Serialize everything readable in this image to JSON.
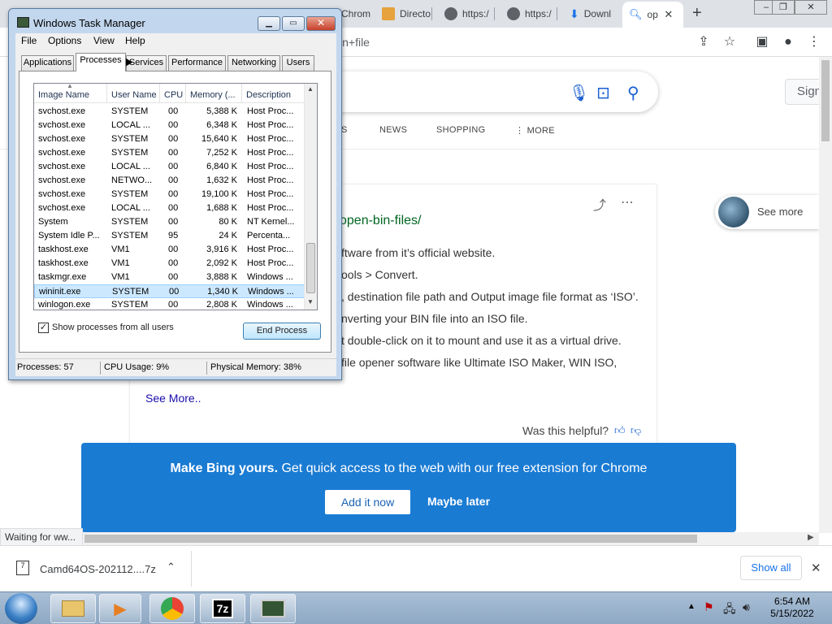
{
  "browser": {
    "tabs": [
      {
        "label": "Chrom"
      },
      {
        "label": "Directo"
      },
      {
        "label": "https:/"
      },
      {
        "label": "https:/"
      },
      {
        "label": "Downl"
      },
      {
        "label": "op"
      }
    ],
    "new_tab": "+",
    "window_controls": {
      "minimize": "–",
      "maximize": "❐",
      "close": "✕"
    },
    "omnibox_text": "in+file"
  },
  "page": {
    "sign_in": "Sign",
    "nav": [
      {
        "label": "S"
      },
      {
        "label": "NEWS"
      },
      {
        "label": "SHOPPING"
      },
      {
        "label": "⋮ MORE"
      }
    ],
    "answer_link": "open-bin-files/",
    "answer_lines": [
      "ftware from it’s official website.",
      "ools > Convert.",
      ", destination file path and Output image file format as ‘ISO’.",
      "nverting your BIN file into an ISO file.",
      "t double-click on it to mount and use it as a virtual drive.",
      " file opener software like Ultimate ISO Maker, WIN ISO,"
    ],
    "see_more_link": "See More..",
    "helpful": "Was this helpful?",
    "see_more_pill": "See more",
    "banner": {
      "bold": "Make Bing yours.",
      "text": " Get quick access to the web with our free extension for Chrome",
      "add_button": "Add it now",
      "later_button": "Maybe later"
    },
    "status_bubble": "Waiting for ww..."
  },
  "downloads": {
    "file_name": "Camd64OS-202112....7z",
    "show_all": "Show all",
    "close": "✕"
  },
  "taskbar": {
    "time": "6:54 AM",
    "date": "5/15/2022"
  },
  "task_manager": {
    "title": "Windows Task Manager",
    "controls": {
      "minimize": "▁",
      "maximize": "▭",
      "close": "✕"
    },
    "menu": [
      {
        "label": "File"
      },
      {
        "label": "Options"
      },
      {
        "label": "View"
      },
      {
        "label": "Help"
      }
    ],
    "tabs": [
      {
        "label": "Applications"
      },
      {
        "label": "Processes"
      },
      {
        "label": "Services"
      },
      {
        "label": "Performance"
      },
      {
        "label": "Networking"
      },
      {
        "label": "Users"
      }
    ],
    "columns": [
      {
        "label": "Image Name"
      },
      {
        "label": "User Name"
      },
      {
        "label": "CPU"
      },
      {
        "label": "Memory (..."
      },
      {
        "label": "Description"
      }
    ],
    "processes": [
      {
        "name": "svchost.exe",
        "user": "SYSTEM",
        "cpu": "00",
        "mem": "5,388 K",
        "desc": "Host Proc..."
      },
      {
        "name": "svchost.exe",
        "user": "LOCAL ...",
        "cpu": "00",
        "mem": "6,348 K",
        "desc": "Host Proc..."
      },
      {
        "name": "svchost.exe",
        "user": "SYSTEM",
        "cpu": "00",
        "mem": "15,640 K",
        "desc": "Host Proc..."
      },
      {
        "name": "svchost.exe",
        "user": "SYSTEM",
        "cpu": "00",
        "mem": "7,252 K",
        "desc": "Host Proc..."
      },
      {
        "name": "svchost.exe",
        "user": "LOCAL ...",
        "cpu": "00",
        "mem": "6,840 K",
        "desc": "Host Proc..."
      },
      {
        "name": "svchost.exe",
        "user": "NETWO...",
        "cpu": "00",
        "mem": "1,632 K",
        "desc": "Host Proc..."
      },
      {
        "name": "svchost.exe",
        "user": "SYSTEM",
        "cpu": "00",
        "mem": "19,100 K",
        "desc": "Host Proc..."
      },
      {
        "name": "svchost.exe",
        "user": "LOCAL ...",
        "cpu": "00",
        "mem": "1,688 K",
        "desc": "Host Proc..."
      },
      {
        "name": "System",
        "user": "SYSTEM",
        "cpu": "00",
        "mem": "80 K",
        "desc": "NT Kernel..."
      },
      {
        "name": "System Idle P...",
        "user": "SYSTEM",
        "cpu": "95",
        "mem": "24 K",
        "desc": "Percenta..."
      },
      {
        "name": "taskhost.exe",
        "user": "VM1",
        "cpu": "00",
        "mem": "3,916 K",
        "desc": "Host Proc..."
      },
      {
        "name": "taskhost.exe",
        "user": "VM1",
        "cpu": "00",
        "mem": "2,092 K",
        "desc": "Host Proc..."
      },
      {
        "name": "taskmgr.exe",
        "user": "VM1",
        "cpu": "00",
        "mem": "3,888 K",
        "desc": "Windows ..."
      },
      {
        "name": "wininit.exe",
        "user": "SYSTEM",
        "cpu": "00",
        "mem": "1,340 K",
        "desc": "Windows ...",
        "selected": true
      },
      {
        "name": "winlogon.exe",
        "user": "SYSTEM",
        "cpu": "00",
        "mem": "2,808 K",
        "desc": "Windows ..."
      }
    ],
    "show_all_processes": "Show processes from all users",
    "end_process": "End Process",
    "status": {
      "processes": "Processes: 57",
      "cpu": "CPU Usage: 9%",
      "memory": "Physical Memory: 38%"
    }
  }
}
